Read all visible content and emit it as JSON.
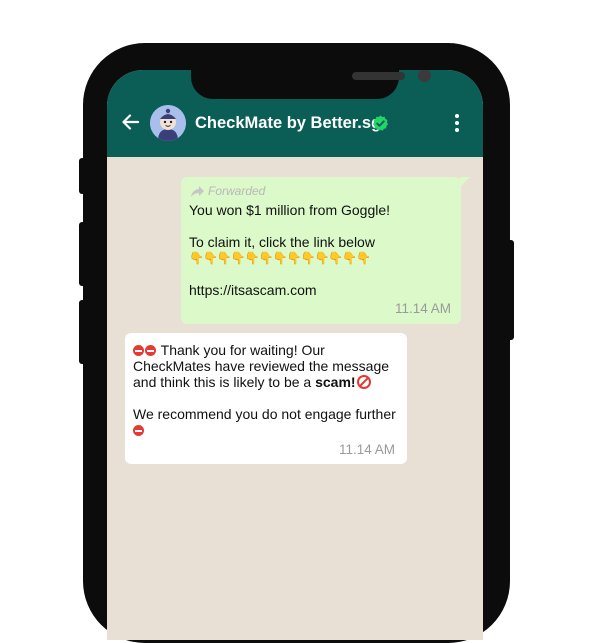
{
  "header": {
    "title": "CheckMate by Better.sg",
    "accent_color": "#0b5e55",
    "back_icon": "arrow-left-icon",
    "verified_icon": "verified-badge-icon",
    "menu_icon": "more-vert-icon"
  },
  "chat": {
    "background_color": "#e8e0d4",
    "outgoing": {
      "forwarded_label": "Forwarded",
      "line1": "You won $1 million from Goggle!",
      "line2": "To claim it, click the link below",
      "pointers": "👇👇👇👇👇👇👇👇👇👇👇👇👇",
      "link": "https://itsascam.com",
      "time": "11.14 AM",
      "bubble_color": "#dbf9c9"
    },
    "incoming": {
      "line1": "Thank you for waiting! Our",
      "line2": "CheckMates have reviewed the message",
      "line3_prefix": "and think this is likely to be a ",
      "line3_bold": "scam!",
      "line4": "We recommend you do not engage further",
      "time": "11.14 AM",
      "bubble_color": "#ffffff"
    }
  }
}
